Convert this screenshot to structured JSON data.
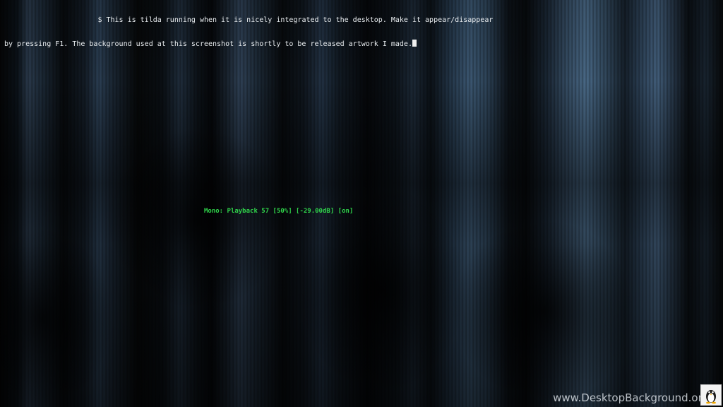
{
  "terminal": {
    "line1": "$ This is tilda running when it is nicely integrated to the desktop. Make it appear/disappear",
    "line2": "by pressing F1. The background used at this screenshot is shortly to be released artwork I made."
  },
  "mixer_status": "Mono: Playback 57 [50%] [-29.00dB] [on]",
  "watermark": {
    "text": "www.DesktopBackground.org",
    "logo_icon": "penguin-icon"
  }
}
